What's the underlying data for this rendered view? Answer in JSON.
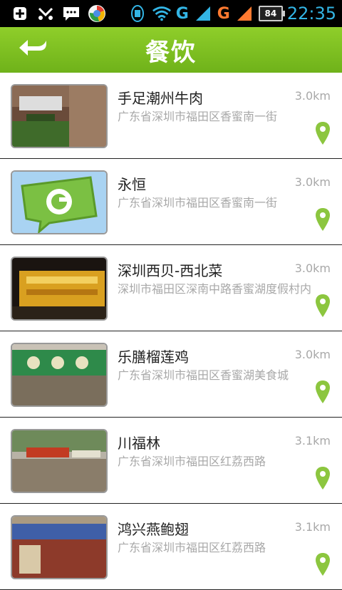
{
  "status_bar": {
    "time": "22:35",
    "battery": "84",
    "net1": "G",
    "net2": "G",
    "sig1_sub": "1",
    "sig2_sub": "2",
    "icons": [
      "add-icon",
      "missed-call-icon",
      "message-icon",
      "browser-icon",
      "data-icon",
      "wifi-icon"
    ]
  },
  "header": {
    "title": "餐饮",
    "back_icon": "back-arrow-icon"
  },
  "restaurants": [
    {
      "name": "手足潮州牛肉",
      "address": "广东省深圳市福田区香蜜南一街",
      "distance": "3.0km"
    },
    {
      "name": "永恒",
      "address": "广东省深圳市福田区香蜜南一街",
      "distance": "3.0km"
    },
    {
      "name": "深圳西贝-西北菜",
      "address": "深圳市福田区深南中路香蜜湖度假村内",
      "distance": "3.0km"
    },
    {
      "name": "乐膳榴莲鸡",
      "address": "广东省深圳市福田区香蜜湖美食城",
      "distance": "3.0km"
    },
    {
      "name": "川福林",
      "address": "广东省深圳市福田区红荔西路",
      "distance": "3.1km"
    },
    {
      "name": "鸿兴燕鲍翅",
      "address": "广东省深圳市福田区红荔西路",
      "distance": "3.1km"
    }
  ],
  "colors": {
    "accent": "#79bd1f",
    "pin": "#8cc63f",
    "status_icon": "#33b5e5"
  }
}
